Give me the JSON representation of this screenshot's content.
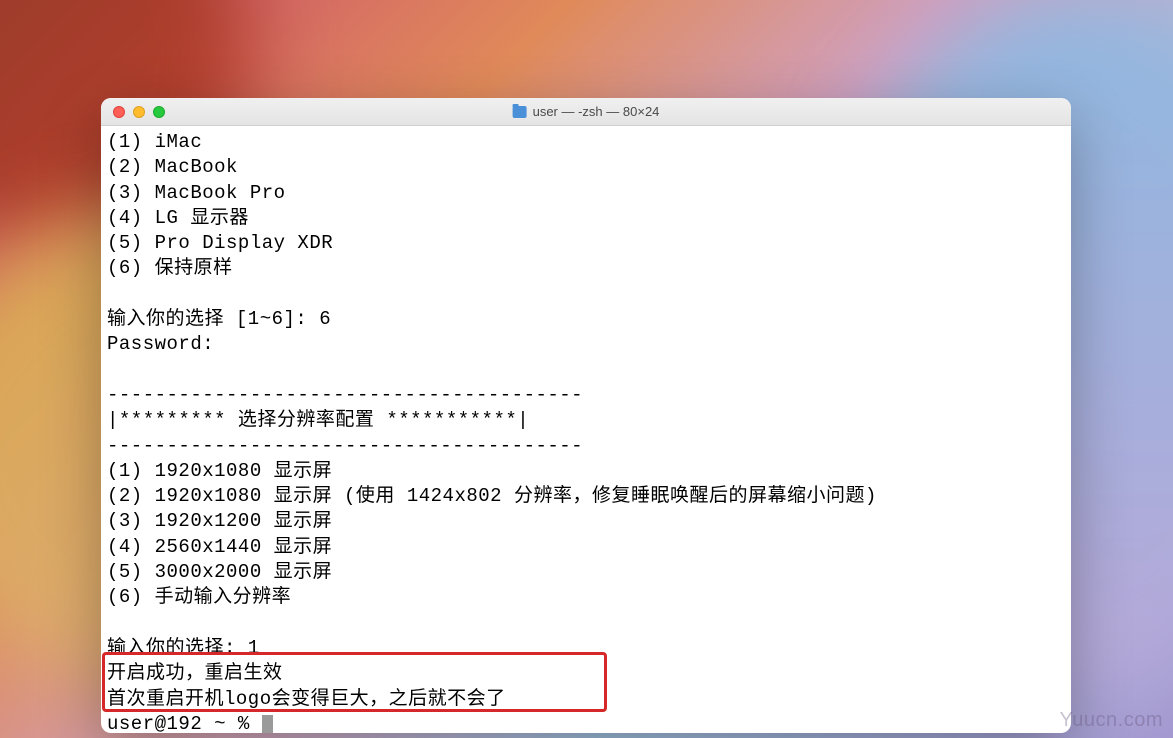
{
  "window": {
    "title": "user — -zsh — 80×24"
  },
  "terminal": {
    "lines": [
      "(1) iMac",
      "(2) MacBook",
      "(3) MacBook Pro",
      "(4) LG 显示器",
      "(5) Pro Display XDR",
      "(6) 保持原样",
      "",
      "输入你的选择 [1~6]: 6",
      "Password:",
      "",
      "----------------------------------------",
      "|********* 选择分辨率配置 ***********|",
      "----------------------------------------",
      "(1) 1920x1080 显示屏",
      "(2) 1920x1080 显示屏 (使用 1424x802 分辨率，修复睡眠唤醒后的屏幕缩小问题)",
      "(3) 1920x1200 显示屏",
      "(4) 2560x1440 显示屏",
      "(5) 3000x2000 显示屏",
      "(6) 手动输入分辨率",
      "",
      "输入你的选择: 1",
      "开启成功，重启生效",
      "首次重启开机logo会变得巨大，之后就不会了"
    ],
    "prompt": "user@192 ~ % "
  },
  "watermark": "Yuucn.com"
}
